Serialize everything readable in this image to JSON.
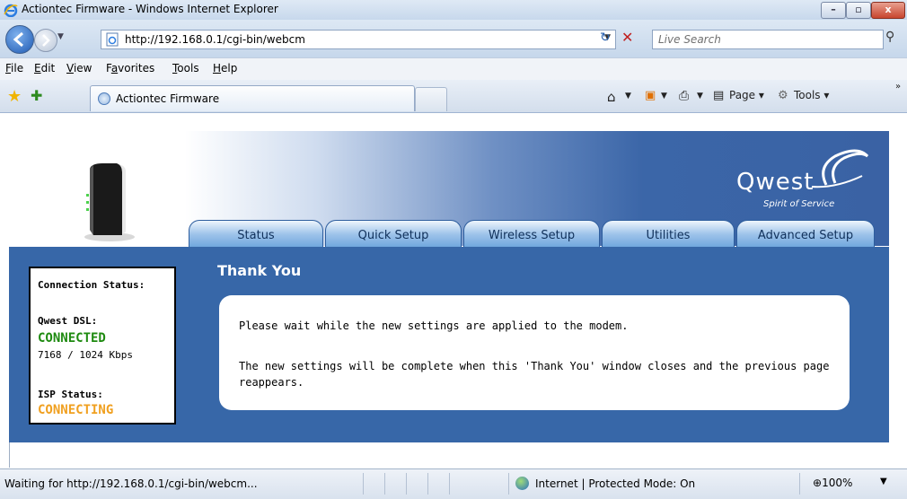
{
  "window": {
    "title": "Actiontec Firmware - Windows Internet Explorer",
    "controls": {
      "minimize": "–",
      "maximize": "▫",
      "close": "x"
    }
  },
  "address_bar": {
    "url": "http://192.168.0.1/cgi-bin/webcm",
    "search_placeholder": "Live Search"
  },
  "menu": {
    "items": [
      {
        "label": "File",
        "accel": "F"
      },
      {
        "label": "Edit",
        "accel": "E"
      },
      {
        "label": "View",
        "accel": "V"
      },
      {
        "label": "Favorites",
        "accel": "a"
      },
      {
        "label": "Tools",
        "accel": "T"
      },
      {
        "label": "Help",
        "accel": "H"
      }
    ]
  },
  "tabs_bar": {
    "active_tab_title": "Actiontec Firmware",
    "tools": {
      "page": "Page",
      "tools": "Tools"
    }
  },
  "router": {
    "brand": "Qwest",
    "tagline": "Spirit of Service",
    "nav_tabs": [
      "Status",
      "Quick Setup",
      "Wireless Setup",
      "Utilities",
      "Advanced Setup"
    ],
    "connection_status": {
      "heading": "Connection Status:",
      "dsl_label": "Qwest DSL:",
      "dsl_state": "CONNECTED",
      "dsl_rate": "7168 / 1024 Kbps",
      "isp_label": "ISP Status:",
      "isp_state": "CONNECTING"
    },
    "page_title": "Thank You",
    "messages": {
      "line1": "Please wait while the new settings are applied to the modem.",
      "line2a": "The new settings will be complete when this 'Thank You' window closes and the previous page",
      "line2b": "reappears."
    }
  },
  "statusbar": {
    "text": "Waiting for http://192.168.0.1/cgi-bin/webcm...",
    "zone": "Internet | Protected Mode: On",
    "zoom": "100%"
  },
  "colors": {
    "panel_bg": "#3767a8",
    "connected": "#1e8a10",
    "connecting": "#f0a020"
  }
}
